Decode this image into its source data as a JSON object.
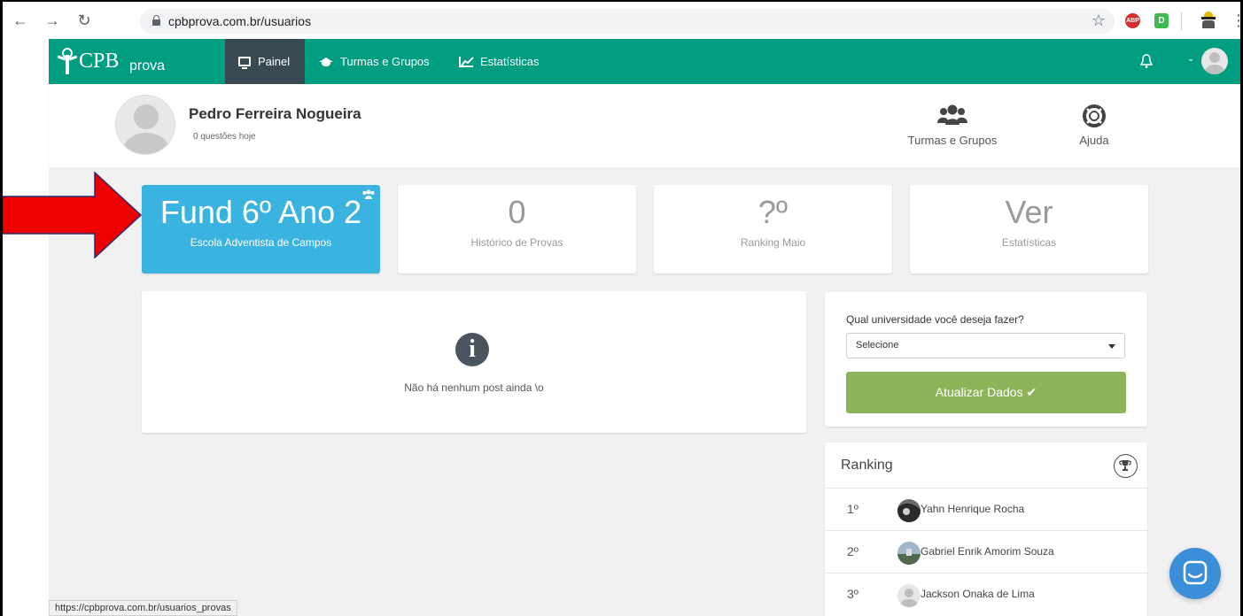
{
  "browser": {
    "url": "cpbprova.com.br/usuarios",
    "extensions": [
      "ABP",
      "D"
    ],
    "status_url": "https://cpbprova.com.br/usuarios_provas"
  },
  "navbar": {
    "logo_main": "CPB",
    "logo_sub": "prova",
    "items": [
      {
        "label": "Painel",
        "icon": "monitor-icon",
        "active": true
      },
      {
        "label": "Turmas e Grupos",
        "icon": "graduation-cap-icon",
        "active": false
      },
      {
        "label": "Estatísticas",
        "icon": "line-chart-icon",
        "active": false
      }
    ],
    "bg_color": "#009d80"
  },
  "profile": {
    "name": "Pedro Ferreira Nogueira",
    "subtitle": "0 questões hoje",
    "links": [
      {
        "label": "Turmas e Grupos",
        "icon": "users-icon"
      },
      {
        "label": "Ajuda",
        "icon": "life-ring-icon"
      }
    ]
  },
  "stats": [
    {
      "big": "Fund 6º Ano 2",
      "small": "Escola Adventista de Campos",
      "highlight": true
    },
    {
      "big": "0",
      "small": "Histórico de Provas",
      "highlight": false
    },
    {
      "big": "?º",
      "small": "Ranking Maio",
      "highlight": false
    },
    {
      "big": "Ver",
      "small": "Estatísticas",
      "highlight": false
    }
  ],
  "posts": {
    "empty_message": "Não há nenhum post ainda \\o"
  },
  "university": {
    "question": "Qual universidade você deseja fazer?",
    "selected": "Selecione",
    "button_label": "Atualizar Dados ✔"
  },
  "ranking": {
    "title": "Ranking",
    "rows": [
      {
        "pos": "1º",
        "name": "Yahn Henrique Rocha"
      },
      {
        "pos": "2º",
        "name": "Gabriel Enrik Amorim Souza"
      },
      {
        "pos": "3º",
        "name": "Jackson Onaka de Lima"
      }
    ]
  },
  "colors": {
    "accent_blue": "#3bb3e0",
    "button_green": "#8cb55a",
    "arrow_red": "#ee0000"
  }
}
